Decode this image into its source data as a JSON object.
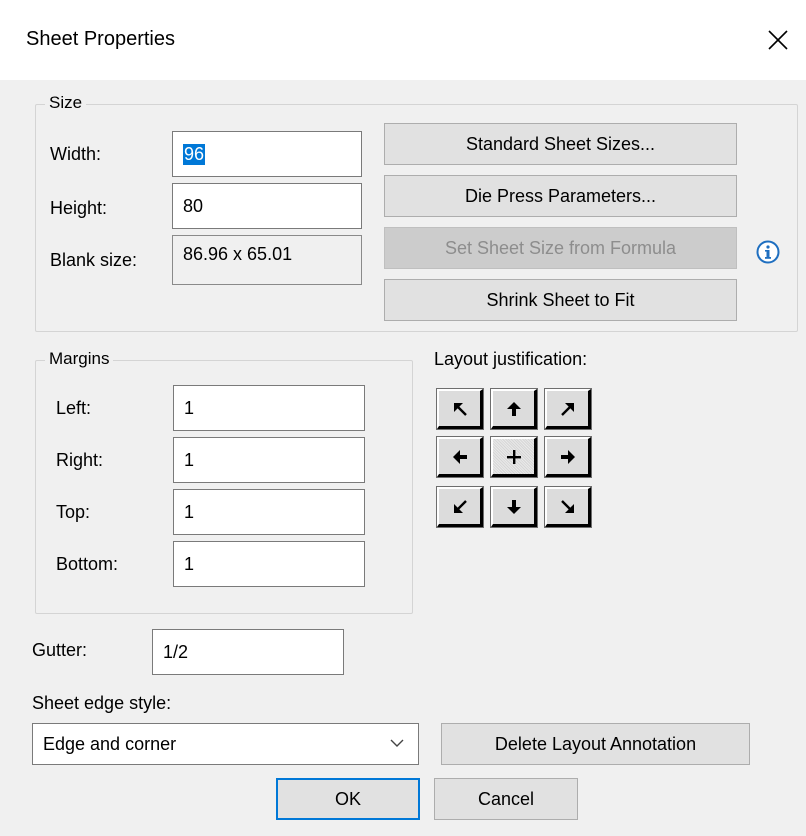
{
  "dialog": {
    "title": "Sheet Properties"
  },
  "size_group": {
    "legend": "Size",
    "width_label": "Width:",
    "width_value": "96",
    "height_label": "Height:",
    "height_value": "80",
    "blank_label": "Blank size:",
    "blank_value": "86.96 x 65.01",
    "standard_sizes_button": "Standard Sheet Sizes...",
    "die_press_button": "Die Press Parameters...",
    "formula_button": "Set Sheet Size from Formula",
    "shrink_button": "Shrink Sheet to Fit",
    "info_icon": "info-icon"
  },
  "margins_group": {
    "legend": "Margins",
    "left_label": "Left:",
    "left_value": "1",
    "right_label": "Right:",
    "right_value": "1",
    "top_label": "Top:",
    "top_value": "1",
    "bottom_label": "Bottom:",
    "bottom_value": "1"
  },
  "layout": {
    "label": "Layout justification:",
    "buttons": [
      "arrow-up-left-icon",
      "arrow-up-icon",
      "arrow-up-right-icon",
      "arrow-left-icon",
      "plus-center-icon",
      "arrow-right-icon",
      "arrow-down-left-icon",
      "arrow-down-icon",
      "arrow-down-right-icon"
    ],
    "selected": "center"
  },
  "gutter": {
    "label": "Gutter:",
    "value": "1/2"
  },
  "edge_style": {
    "label": "Sheet edge style:",
    "selected": "Edge and corner"
  },
  "buttons": {
    "delete_annotation": "Delete Layout Annotation",
    "ok": "OK",
    "cancel": "Cancel"
  },
  "colors": {
    "selection": "#0078d7",
    "dialog_bg": "#f0f0f0",
    "info_icon": "#1f6fc0"
  }
}
